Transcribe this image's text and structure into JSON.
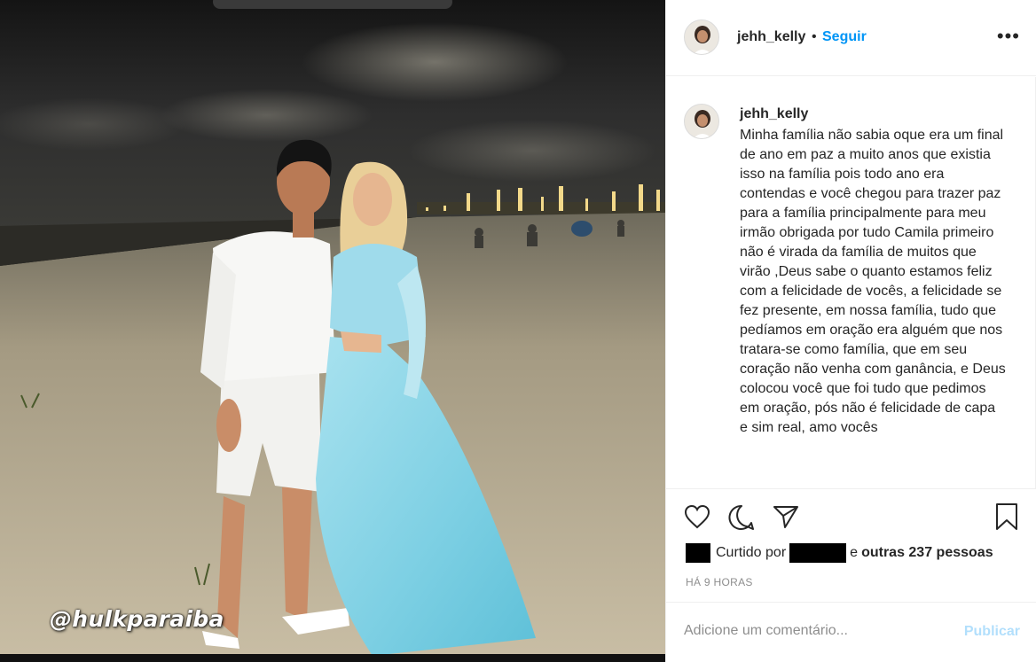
{
  "photo": {
    "tag_text": "@hulkparaiba"
  },
  "header": {
    "username": "jehh_kelly",
    "separator": "•",
    "follow_label": "Seguir",
    "more_icon": "more-options-icon",
    "more_label": "•••"
  },
  "caption": {
    "username": "jehh_kelly",
    "text": "Minha família não sabia oque era um final de ano em paz a muito anos que existia isso na família pois todo ano era contendas e você chegou para trazer paz para a família principalmente para meu irmão obrigada por tudo Camila primeiro não é virada da família de muitos que virão ,Deus sabe o quanto estamos feliz com a felicidade de vocês, a felicidade se fez presente, em nossa família, tudo que pedíamos em oração era alguém que nos tratara-se como família, que em seu coração não venha com ganância, e Deus colocou você que foi tudo que pedimos em oração, pós não é felicidade de capa e sim real, amo vocês"
  },
  "actions": {
    "icons": [
      "heart-icon",
      "comment-icon",
      "share-icon",
      "bookmark-icon"
    ]
  },
  "likes": {
    "prefix": "Curtido por",
    "connector": "e",
    "others": "outras 237 pessoas"
  },
  "timestamp": "HÁ 9 HORAS",
  "comment": {
    "placeholder": "Adicione um comentário...",
    "publish_label": "Publicar"
  },
  "colors": {
    "accent": "#0095f6",
    "publish_disabled": "#b2dffc",
    "text": "#262626",
    "muted": "#8e8e8e"
  }
}
